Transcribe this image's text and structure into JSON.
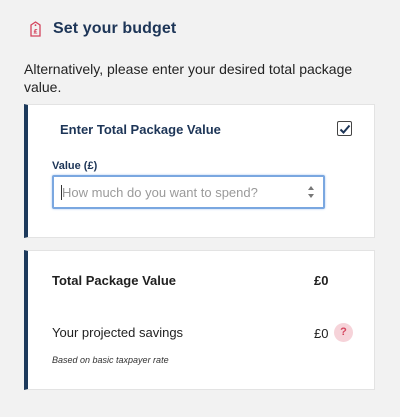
{
  "header": {
    "icon": "price-tag-icon",
    "title": "Set your budget"
  },
  "intro": "Alternatively, please enter your desired total package value.",
  "package_card": {
    "title": "Enter Total Package Value",
    "checked": true,
    "field": {
      "label": "Value (£)",
      "value": "",
      "placeholder": "How much do you want to spend?"
    }
  },
  "summary_card": {
    "total_label": "Total Package Value",
    "total_value": "£0",
    "savings_label": "Your projected savings",
    "savings_value": "£0",
    "help_glyph": "?",
    "note": "Based on basic taxpayer rate"
  },
  "colors": {
    "accent_navy": "#1d3557",
    "card_border_left": "#1d3a5c",
    "pink_icon": "#d4445d",
    "help_bg": "#f6d3d9",
    "input_focus": "#7aa7e0"
  }
}
